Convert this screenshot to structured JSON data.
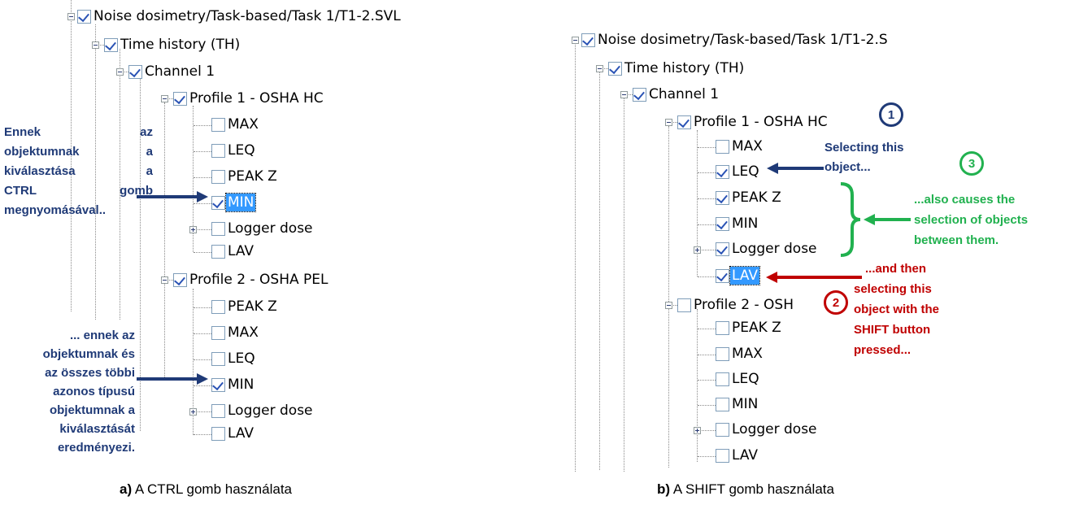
{
  "panel_a": {
    "root": "Noise dosimetry/Task-based/Task 1/T1-2.SVL",
    "time_history": "Time history (TH)",
    "channel": "Channel 1",
    "profile1": "Profile 1 - OSHA HC",
    "p1_items": [
      "MAX",
      "LEQ",
      "PEAK Z",
      "MIN",
      "Logger dose",
      "LAV"
    ],
    "profile2": "Profile 2 - OSHA PEL",
    "p2_items": [
      "PEAK Z",
      "MAX",
      "LEQ",
      "MIN",
      "Logger dose",
      "LAV"
    ],
    "note1": [
      "Ennek az",
      "objektumnak a",
      "kiválasztása a",
      "CTRL gomb",
      "megnyomásával.."
    ],
    "note2": [
      "... ennek az",
      "objektumnak és",
      "az összes többi",
      "azonos típusú",
      "objektumnak a",
      "kiválasztását",
      "eredményezi."
    ],
    "caption_bold": "a)",
    "caption_text": " A CTRL gomb használata"
  },
  "panel_b": {
    "root": "Noise dosimetry/Task-based/Task 1/T1-2.S",
    "time_history": "Time history (TH)",
    "channel": "Channel 1",
    "profile1": "Profile 1 - OSHA HC",
    "p1_items": [
      "MAX",
      "LEQ",
      "PEAK Z",
      "MIN",
      "Logger dose",
      "LAV"
    ],
    "profile2": "Profile 2 - OSH",
    "p2_items": [
      "PEAK Z",
      "MAX",
      "LEQ",
      "MIN",
      "Logger dose",
      "LAV"
    ],
    "badge1": "1",
    "badge2": "2",
    "badge3": "3",
    "note1": [
      "Selecting this",
      "object..."
    ],
    "note2": [
      "...and then",
      "selecting this",
      "object with the",
      "SHIFT button",
      "pressed..."
    ],
    "note3": [
      "...also causes the",
      "selection of objects",
      "between them."
    ],
    "caption_bold": "b)",
    "caption_text": " A SHIFT gomb használata"
  },
  "colors": {
    "blue": "#1f3a77",
    "green": "#21b14f",
    "red": "#c00000",
    "selection": "#3399ff"
  }
}
